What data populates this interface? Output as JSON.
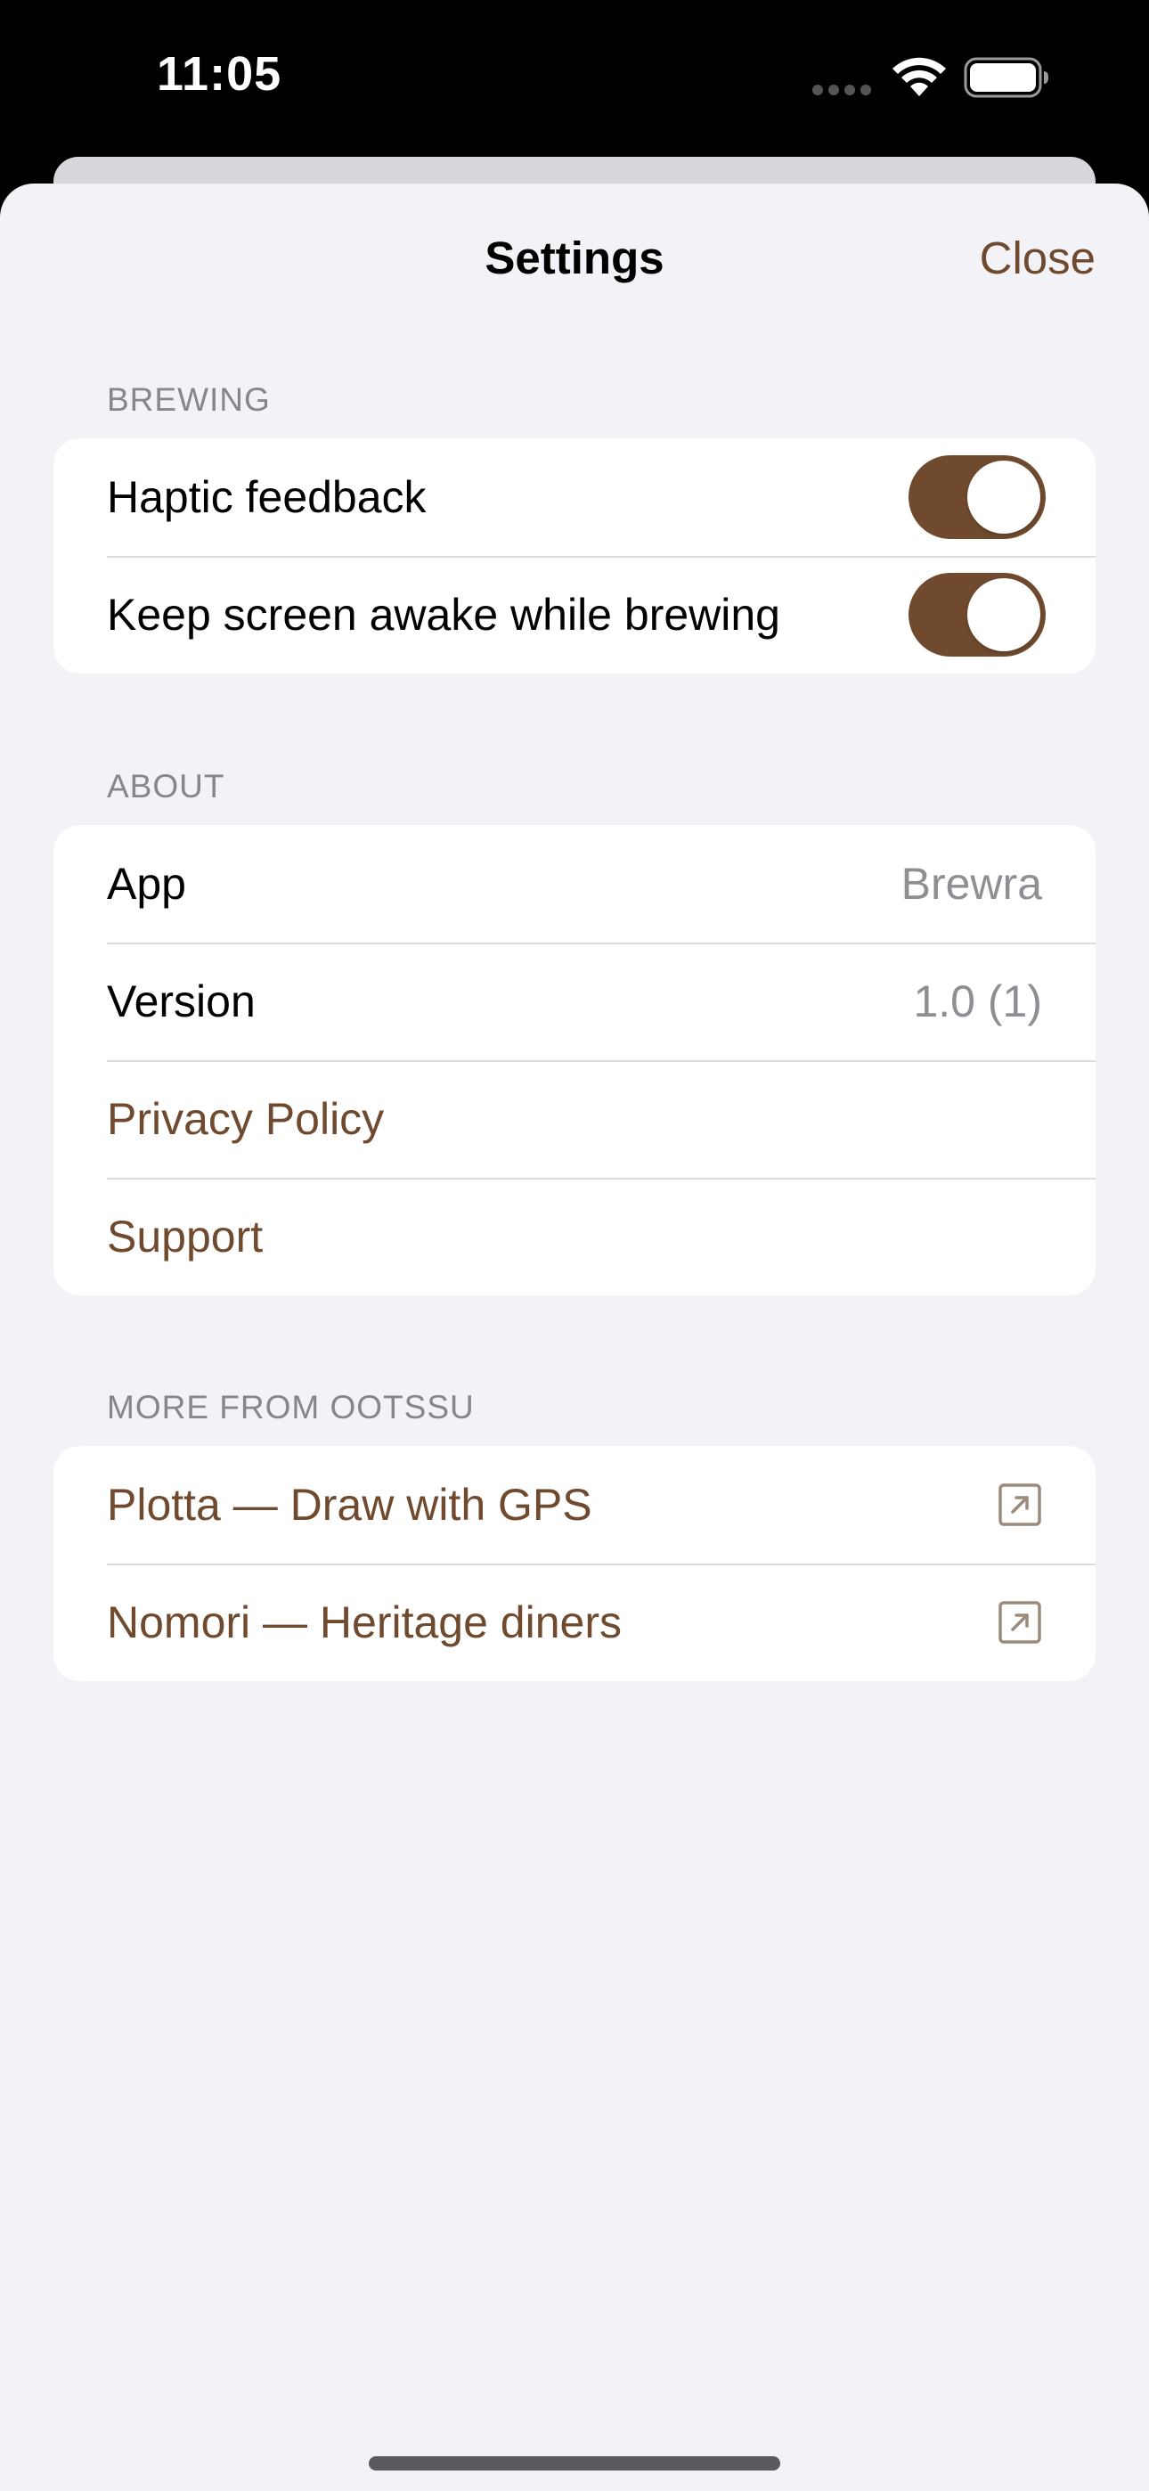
{
  "status_bar": {
    "time": "11:05",
    "icons": [
      "signal-dots-icon",
      "wifi-icon",
      "battery-icon"
    ]
  },
  "nav": {
    "title": "Settings",
    "close_label": "Close"
  },
  "colors": {
    "accent": "#6f4a2e",
    "background": "#f2f2f7",
    "secondary_text": "#8e8e93"
  },
  "sections": {
    "brewing": {
      "header": "BREWING",
      "rows": [
        {
          "label": "Haptic feedback",
          "toggle_on": true
        },
        {
          "label": "Keep screen awake while brewing",
          "toggle_on": true
        }
      ]
    },
    "about": {
      "header": "ABOUT",
      "rows": [
        {
          "label": "App",
          "value": "Brewra"
        },
        {
          "label": "Version",
          "value": "1.0 (1)"
        },
        {
          "label": "Privacy Policy"
        },
        {
          "label": "Support"
        }
      ]
    },
    "more": {
      "header": "MORE FROM OOTSSU",
      "rows": [
        {
          "label": "Plotta — Draw with GPS",
          "icon": "external-link-icon"
        },
        {
          "label": "Nomori — Heritage diners",
          "icon": "external-link-icon"
        }
      ]
    }
  }
}
